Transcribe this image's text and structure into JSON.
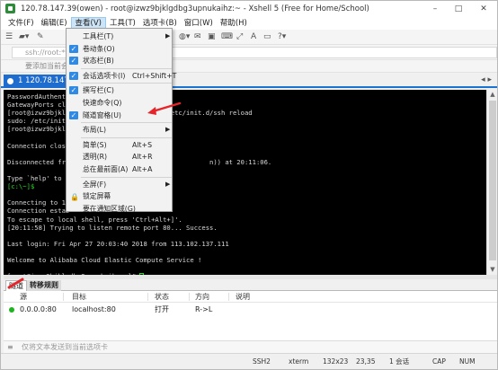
{
  "window": {
    "title": "120.78.147.39(owen) - root@izwz9bjklgdbg3upnukaihz:~ - Xshell 5 (Free for Home/School)",
    "controls": [
      "–",
      "□",
      "✕"
    ]
  },
  "menubar": {
    "items": [
      {
        "label": "文件(F)"
      },
      {
        "label": "编辑(E)"
      },
      {
        "label": "查看(V)"
      },
      {
        "label": "工具(T)"
      },
      {
        "label": "选项卡(B)"
      },
      {
        "label": "窗口(W)"
      },
      {
        "label": "帮助(H)"
      }
    ],
    "active_index": 2
  },
  "address_bar": {
    "value": "ssh://root:*****@"
  },
  "hint_bar": {
    "text": "要添加当前会话"
  },
  "session_tab": {
    "label": "1 120.78.147.39(o"
  },
  "view_menu": {
    "items": [
      {
        "label": "工具栏(T)",
        "shortcut": "",
        "checked": false,
        "submenu": true
      },
      {
        "label": "卷动条(O)",
        "shortcut": "",
        "checked": true,
        "submenu": false
      },
      {
        "label": "状态栏(B)",
        "shortcut": "",
        "checked": true,
        "submenu": false
      },
      {
        "label": "会话选项卡(I)",
        "shortcut": "Ctrl+Shift+T",
        "checked": true,
        "submenu": false
      },
      {
        "label": "撰写栏(C)",
        "shortcut": "",
        "checked": true,
        "submenu": false
      },
      {
        "label": "快速命令(Q)",
        "shortcut": "",
        "checked": false,
        "submenu": false
      },
      {
        "label": "隧道窗格(U)",
        "shortcut": "",
        "checked": true,
        "submenu": false
      },
      {
        "label": "布局(L)",
        "shortcut": "",
        "checked": false,
        "submenu": true
      },
      {
        "label": "简单(S)",
        "shortcut": "Alt+S",
        "checked": false,
        "submenu": false
      },
      {
        "label": "透明(R)",
        "shortcut": "Alt+R",
        "checked": false,
        "submenu": false
      },
      {
        "label": "总在最前面(A)",
        "shortcut": "Alt+A",
        "checked": false,
        "submenu": false
      },
      {
        "label": "全屏(F)",
        "shortcut": "",
        "checked": false,
        "submenu": true
      },
      {
        "label": "锁定屏幕",
        "shortcut": "",
        "checked": false,
        "submenu": false,
        "lock": true
      },
      {
        "label": "要在通知区域(G)",
        "shortcut": "",
        "checked": false,
        "submenu": false
      }
    ]
  },
  "terminal": {
    "lines": [
      {
        "text": "PasswordAuthentic",
        "style": "normal"
      },
      {
        "text": "GatewayPorts cli",
        "style": "normal"
      },
      {
        "text": "[root@izwz9bjklgd                    ~]# /etc/init.d/ssh reload",
        "style": "normal"
      },
      {
        "text": "sudo: /etc/init.",
        "style": "normal"
      },
      {
        "text": "[root@izwz9bjklgd",
        "style": "normal"
      },
      {
        "text": "",
        "style": "normal"
      },
      {
        "text": "Connection closed",
        "style": "normal"
      },
      {
        "text": "",
        "style": "normal"
      },
      {
        "text": "Disconnected from                                   n)) at 20:11:06.",
        "style": "normal"
      },
      {
        "text": "",
        "style": "normal"
      },
      {
        "text": "Type `help' to le",
        "style": "normal"
      },
      {
        "text": "[c:\\~]$",
        "style": "green"
      },
      {
        "text": "",
        "style": "normal"
      },
      {
        "text": "Connecting to 12",
        "style": "normal"
      },
      {
        "text": "Connection estab",
        "style": "normal"
      },
      {
        "text": "To escape to local shell, press 'Ctrl+Alt+]'.",
        "style": "normal"
      },
      {
        "text": "[20:11:58] Trying to listen remote port 80... Success.",
        "style": "normal"
      },
      {
        "text": "",
        "style": "normal"
      },
      {
        "text": "Last login: Fri Apr 27 20:03:40 2018 from 113.102.137.111",
        "style": "normal"
      },
      {
        "text": "",
        "style": "normal"
      },
      {
        "text": "Welcome to Alibaba Cloud Elastic Compute Service !",
        "style": "normal"
      },
      {
        "text": "",
        "style": "normal"
      },
      {
        "text": "[root@izwz9bjklgdbg3upnukaihz ~]#",
        "style": "prompt"
      }
    ]
  },
  "bottom_tabs": {
    "tab1": "隧道",
    "tab2": "转移规则"
  },
  "tunnel_table": {
    "headers": {
      "source": "源",
      "target": "目标",
      "status": "状态",
      "direction": "方向",
      "description": "说明"
    },
    "rows": [
      {
        "source": "0.0.0.0:80",
        "target": "localhost:80",
        "status": "打开",
        "direction": "R->L",
        "description": ""
      }
    ]
  },
  "compose_bar": {
    "placeholder": "仅将文本发送到当前选项卡"
  },
  "status_bar": {
    "protocol": "SSH2",
    "terminal_type": "xterm",
    "size": "132x23",
    "cursor_pos": "23,35",
    "sessions": "1 会话",
    "caps": "CAP",
    "num": "NUM"
  },
  "colors": {
    "accent": "#1f6ccf",
    "terminal_bg": "#000000",
    "terminal_fg": "#d8d8d8",
    "prompt_green": "#22dd22",
    "annotation_red": "#e5252a",
    "status_ok": "#1fb31f"
  }
}
